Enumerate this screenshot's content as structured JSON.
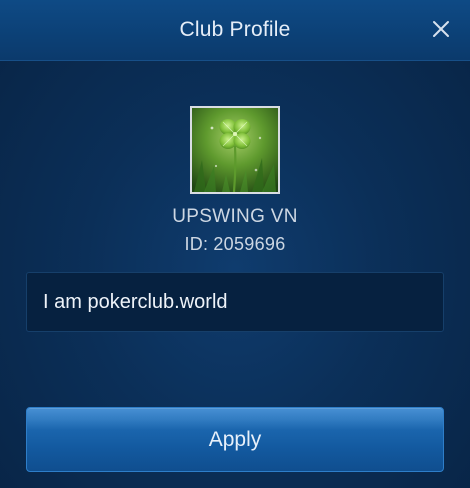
{
  "dialog": {
    "title": "Club Profile",
    "close_icon": "close-icon"
  },
  "club": {
    "avatar_icon": "four-leaf-clover-image",
    "name": "UPSWING VN",
    "id_label": "ID:",
    "id_value": "2059696",
    "description": "I am pokerclub.world"
  },
  "actions": {
    "apply_label": "Apply"
  },
  "colors": {
    "background": "#0b2f58",
    "header": "#0e4a85",
    "button": "#1a65ad",
    "text": "#cdd7e3"
  }
}
